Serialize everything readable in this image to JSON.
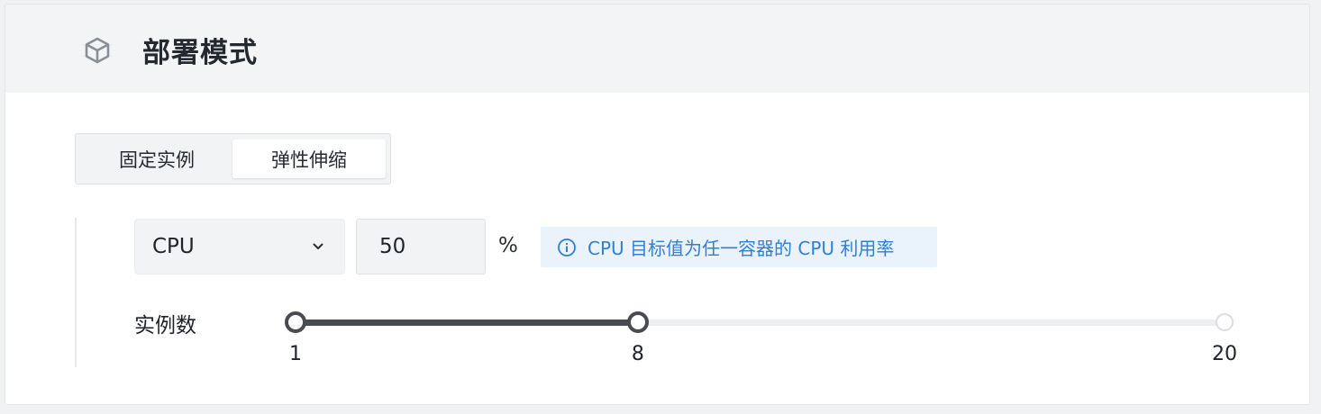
{
  "header": {
    "title": "部署模式",
    "icon": "cube-icon"
  },
  "mode_tabs": [
    {
      "label": "固定实例",
      "selected": false
    },
    {
      "label": "弹性伸缩",
      "selected": true
    }
  ],
  "scaling": {
    "metric": {
      "value": "CPU",
      "icon": "chevron-down-icon"
    },
    "target": {
      "value": "50",
      "unit": "%"
    },
    "hint": {
      "text": "CPU 目标值为任一容器的 CPU 利用率",
      "icon": "info-icon",
      "color": "#2f7fd3"
    },
    "instances": {
      "label": "实例数",
      "min": 1,
      "max": 20,
      "range_start": 1,
      "range_end": 8,
      "labels": {
        "start": "1",
        "end": "8",
        "max": "20"
      }
    }
  }
}
